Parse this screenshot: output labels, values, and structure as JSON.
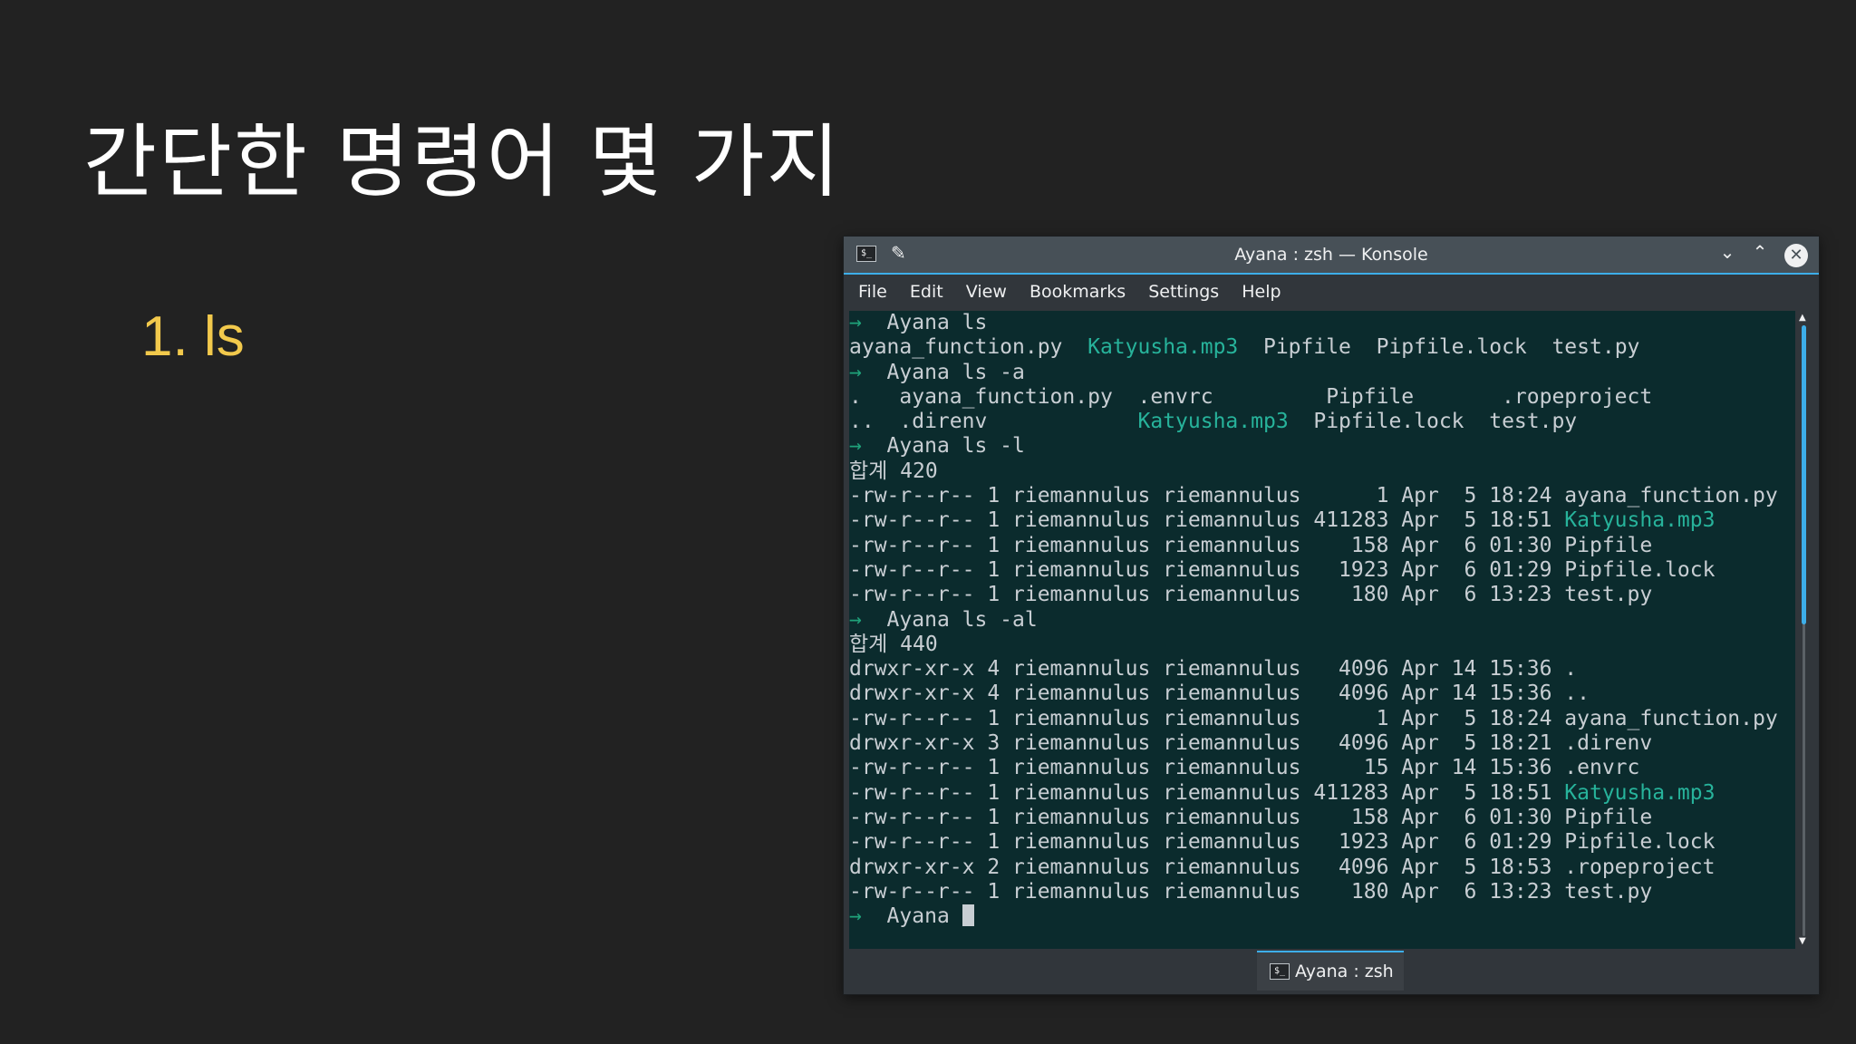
{
  "slide": {
    "title": "간단한 명령어 몇 가지",
    "bullet": "1. ls"
  },
  "window": {
    "title": "Ayana : zsh — Konsole",
    "app_icon": "terminal-icon",
    "app_icon_glyph": "$_",
    "pin_glyph": "✎",
    "minimize_glyph": "⌄",
    "maximize_glyph": "⌃",
    "close_glyph": "✕"
  },
  "menu": {
    "items": [
      "File",
      "Edit",
      "View",
      "Bookmarks",
      "Settings",
      "Help"
    ]
  },
  "terminal": {
    "prompt_arrow": "→",
    "lines": [
      {
        "prompt": true,
        "text": "  Ayana ls"
      },
      {
        "segments": [
          {
            "t": "ayana_function.py  "
          },
          {
            "t": "Katyusha.mp3",
            "c": "mp3"
          },
          {
            "t": "  Pipfile  Pipfile.lock  test.py"
          }
        ]
      },
      {
        "prompt": true,
        "text": "  Ayana ls -a"
      },
      {
        "segments": [
          {
            "t": ".   ayana_function.py  .envrc         Pipfile       .ropeproject"
          }
        ]
      },
      {
        "segments": [
          {
            "t": "..  .direnv            "
          },
          {
            "t": "Katyusha.mp3",
            "c": "mp3"
          },
          {
            "t": "  Pipfile.lock  test.py"
          }
        ]
      },
      {
        "prompt": true,
        "text": "  Ayana ls -l"
      },
      {
        "segments": [
          {
            "t": "합계 420"
          }
        ]
      },
      {
        "segments": [
          {
            "t": "-rw-r--r-- 1 riemannulus riemannulus      1 Apr  5 18:24 ayana_function.py"
          }
        ]
      },
      {
        "segments": [
          {
            "t": "-rw-r--r-- 1 riemannulus riemannulus 411283 Apr  5 18:51 "
          },
          {
            "t": "Katyusha.mp3",
            "c": "mp3"
          }
        ]
      },
      {
        "segments": [
          {
            "t": "-rw-r--r-- 1 riemannulus riemannulus    158 Apr  6 01:30 Pipfile"
          }
        ]
      },
      {
        "segments": [
          {
            "t": "-rw-r--r-- 1 riemannulus riemannulus   1923 Apr  6 01:29 Pipfile.lock"
          }
        ]
      },
      {
        "segments": [
          {
            "t": "-rw-r--r-- 1 riemannulus riemannulus    180 Apr  6 13:23 test.py"
          }
        ]
      },
      {
        "prompt": true,
        "text": "  Ayana ls -al"
      },
      {
        "segments": [
          {
            "t": "합계 440"
          }
        ]
      },
      {
        "segments": [
          {
            "t": "drwxr-xr-x 4 riemannulus riemannulus   4096 Apr 14 15:36 ."
          }
        ]
      },
      {
        "segments": [
          {
            "t": "drwxr-xr-x 4 riemannulus riemannulus   4096 Apr 14 15:36 .."
          }
        ]
      },
      {
        "segments": [
          {
            "t": "-rw-r--r-- 1 riemannulus riemannulus      1 Apr  5 18:24 ayana_function.py"
          }
        ]
      },
      {
        "segments": [
          {
            "t": "drwxr-xr-x 3 riemannulus riemannulus   4096 Apr  5 18:21 .direnv"
          }
        ]
      },
      {
        "segments": [
          {
            "t": "-rw-r--r-- 1 riemannulus riemannulus     15 Apr 14 15:36 .envrc"
          }
        ]
      },
      {
        "segments": [
          {
            "t": "-rw-r--r-- 1 riemannulus riemannulus 411283 Apr  5 18:51 "
          },
          {
            "t": "Katyusha.mp3",
            "c": "mp3"
          }
        ]
      },
      {
        "segments": [
          {
            "t": "-rw-r--r-- 1 riemannulus riemannulus    158 Apr  6 01:30 Pipfile"
          }
        ]
      },
      {
        "segments": [
          {
            "t": "-rw-r--r-- 1 riemannulus riemannulus   1923 Apr  6 01:29 Pipfile.lock"
          }
        ]
      },
      {
        "segments": [
          {
            "t": "drwxr-xr-x 2 riemannulus riemannulus   4096 Apr  5 18:53 .ropeproject"
          }
        ]
      },
      {
        "segments": [
          {
            "t": "-rw-r--r-- 1 riemannulus riemannulus    180 Apr  6 13:23 test.py"
          }
        ]
      },
      {
        "prompt": true,
        "text": "  Ayana ",
        "cursor": true
      }
    ]
  },
  "scrollbar": {
    "position_fraction": 0.49
  },
  "tabs": [
    {
      "label": "Ayana : zsh",
      "icon": "terminal-icon",
      "icon_glyph": "$_",
      "active": true
    }
  ],
  "colors": {
    "background": "#222222",
    "title_text": "#ffffff",
    "bullet_text": "#f2c94c",
    "terminal_bg": "#0b2b2d",
    "terminal_text": "#c8ced3",
    "prompt_arrow": "#1fa37a",
    "media_file": "#27b39b",
    "accent": "#3daee9"
  }
}
